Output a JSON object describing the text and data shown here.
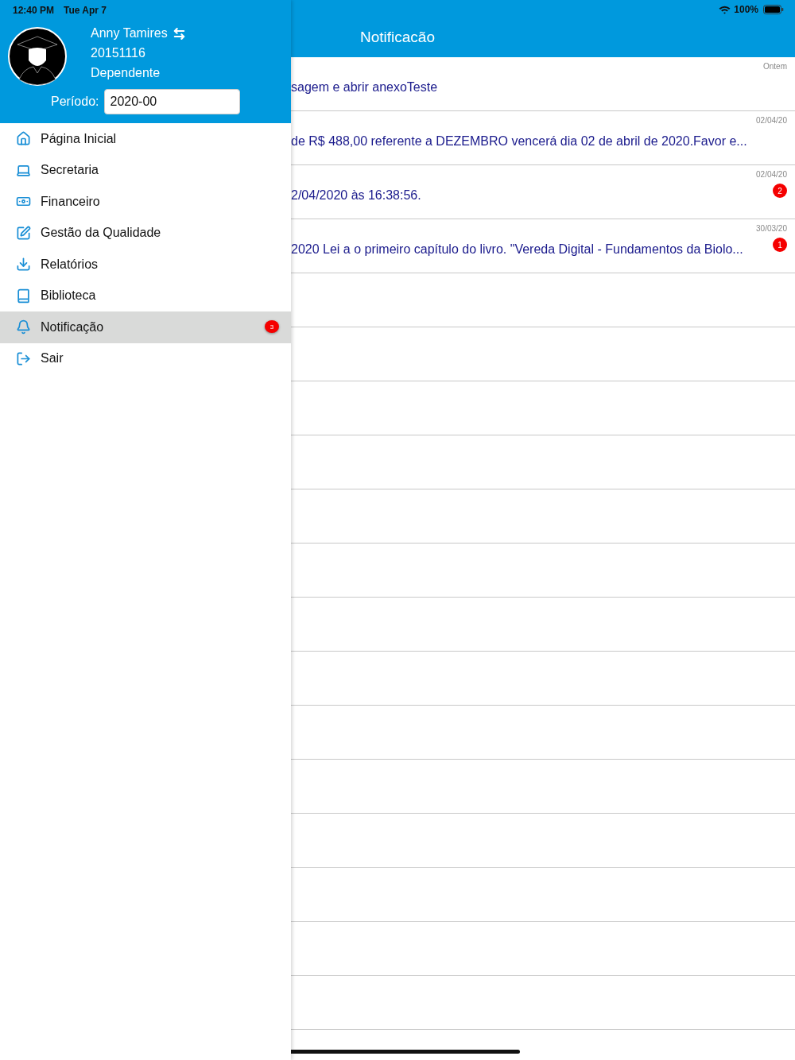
{
  "status_bar": {
    "time": "12:40 PM",
    "date": "Tue Apr 7",
    "battery": "100%"
  },
  "profile": {
    "name": "Anny Tamires",
    "id": "20151116",
    "role": "Dependente",
    "period_label": "Período:",
    "period_value": "2020-00"
  },
  "menu": [
    {
      "label": "Página Inicial",
      "kind": "home",
      "selected": false
    },
    {
      "label": "Secretaria",
      "kind": "laptop",
      "selected": false
    },
    {
      "label": "Financeiro",
      "kind": "money",
      "selected": false
    },
    {
      "label": "Gestão da Qualidade",
      "kind": "edit",
      "selected": false
    },
    {
      "label": "Relatórios",
      "kind": "download",
      "selected": false
    },
    {
      "label": "Biblioteca",
      "kind": "book",
      "selected": false
    },
    {
      "label": "Notificação",
      "kind": "bell",
      "selected": true,
      "badge": "3"
    },
    {
      "label": "Sair",
      "kind": "exit",
      "selected": false
    }
  ],
  "header": {
    "title": "Notificacão"
  },
  "notifications": [
    {
      "date": "Ontem",
      "text": "sagem e abrir anexoTeste"
    },
    {
      "date": "02/04/20",
      "text": "de R$ 488,00 referente a DEZEMBRO vencerá dia 02 de abril de 2020.Favor e..."
    },
    {
      "date": "02/04/20",
      "text": "2/04/2020 às 16:38:56.",
      "badge": "2"
    },
    {
      "date": "30/03/20",
      "text": "2020 Lei a o primeiro capítulo do livro. \"Vereda Digital - Fundamentos da Biolo...",
      "badge": "1"
    }
  ]
}
